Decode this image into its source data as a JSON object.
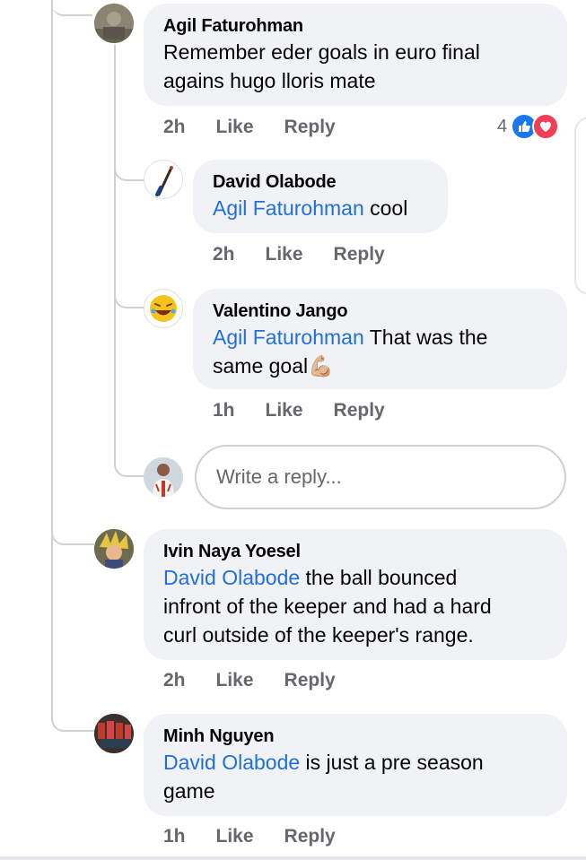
{
  "thread": {
    "comments": [
      {
        "name": "Agil Faturohman",
        "mention": "",
        "text_line1": "Remember eder goals in euro final",
        "text_line2": "agains hugo lloris mate",
        "time": "2h",
        "like": "Like",
        "reply": "Reply",
        "reaction_count": "4",
        "reactions": [
          "like-icon",
          "love-icon"
        ]
      },
      {
        "name": "David Olabode",
        "mention": "Agil Faturohman",
        "text": "cool",
        "time": "2h",
        "like": "Like",
        "reply": "Reply"
      },
      {
        "name": "Valentino Jango",
        "mention": "Agil Faturohman",
        "text_line1": "That was the",
        "text_line2": "same goal",
        "emoji": "💪🏼",
        "time": "1h",
        "like": "Like",
        "reply": "Reply"
      },
      {
        "name": "Ivin Naya Yoesel",
        "mention": "David Olabode",
        "text_line1": " the ball bounced",
        "text_line2": "infront of the keeper and had a hard",
        "text_line3": "curl outside of the keeper's range.",
        "time": "2h",
        "like": "Like",
        "reply": "Reply"
      },
      {
        "name": "Minh Nguyen",
        "mention": "David Olabode",
        "text_line1": " is just a pre season",
        "text_line2": "game",
        "time": "1h",
        "like": "Like",
        "reply": "Reply"
      }
    ],
    "reply_input": {
      "placeholder": "Write a reply..."
    }
  },
  "colors": {
    "bubble": "#f0f2f5",
    "mention": "#216fdb",
    "meta": "#65676b",
    "like_blue": "#1877f2",
    "love_red": "#f33e58",
    "thread_line": "#ced0d4"
  }
}
